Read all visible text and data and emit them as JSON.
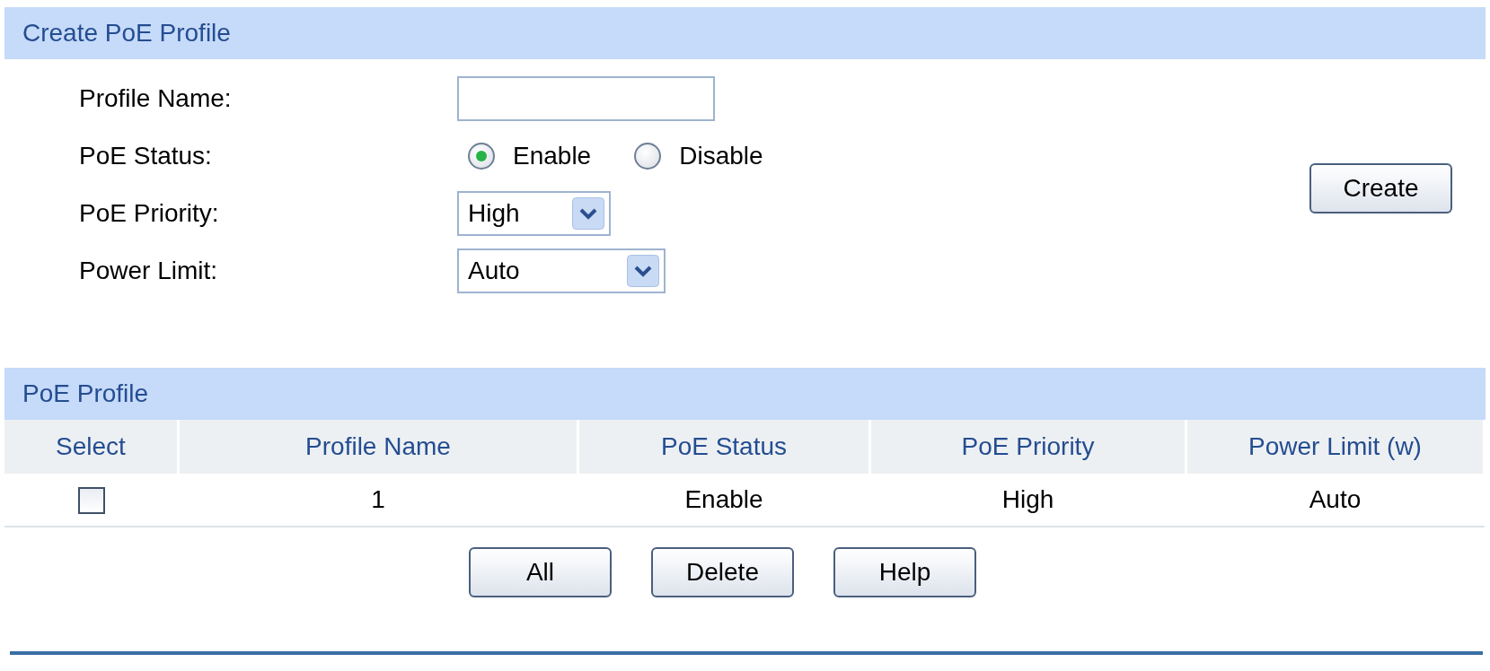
{
  "create_section": {
    "title": "Create PoE Profile",
    "fields": [
      {
        "kind": "text",
        "label": "Profile Name:"
      },
      {
        "kind": "radio",
        "label": "PoE Status:",
        "options": [
          {
            "label": "Enable",
            "selected": true
          },
          {
            "label": "Disable",
            "selected": false
          }
        ]
      },
      {
        "kind": "select",
        "label": "PoE Priority:",
        "value": "High"
      },
      {
        "kind": "select",
        "label": "Power Limit:",
        "value": "Auto"
      }
    ],
    "button": "Create"
  },
  "profile_section": {
    "title": "PoE Profile",
    "columns": [
      "Select",
      "Profile Name",
      "PoE Status",
      "PoE Priority",
      "Power Limit (w)"
    ],
    "rows": [
      {
        "cells": [
          {
            "kind": "checkbox",
            "checked": false
          },
          {
            "kind": "text",
            "text": "1"
          },
          {
            "kind": "text",
            "text": "Enable"
          },
          {
            "kind": "text",
            "text": "High"
          },
          {
            "kind": "text",
            "text": "Auto"
          }
        ]
      }
    ]
  },
  "buttons": [
    "All",
    "Delete",
    "Help"
  ]
}
